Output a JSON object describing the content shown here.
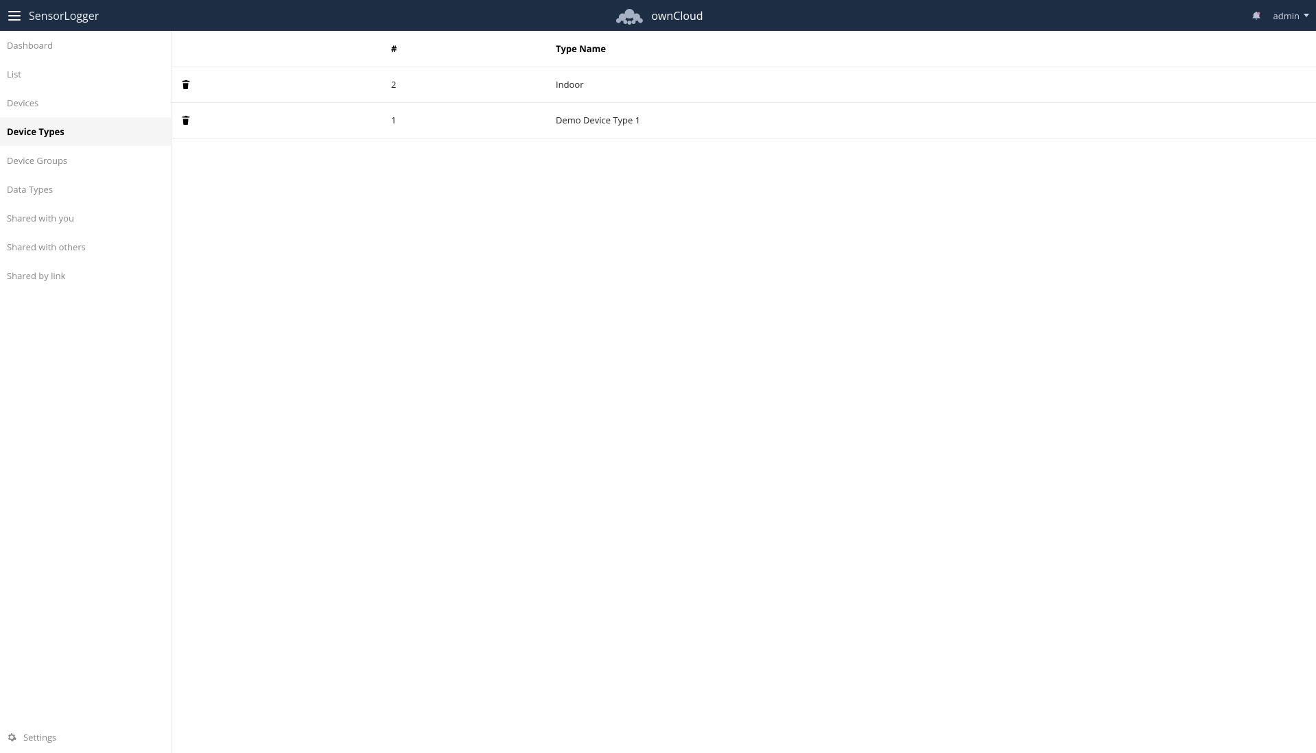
{
  "header": {
    "app_title": "SensorLogger",
    "brand": "ownCloud",
    "user_label": "admin"
  },
  "sidebar": {
    "items": [
      {
        "label": "Dashboard",
        "active": false
      },
      {
        "label": "List",
        "active": false
      },
      {
        "label": "Devices",
        "active": false
      },
      {
        "label": "Device Types",
        "active": true
      },
      {
        "label": "Device Groups",
        "active": false
      },
      {
        "label": "Data Types",
        "active": false
      },
      {
        "label": "Shared with you",
        "active": false
      },
      {
        "label": "Shared with others",
        "active": false
      },
      {
        "label": "Shared by link",
        "active": false
      }
    ],
    "footer": {
      "settings_label": "Settings"
    }
  },
  "table": {
    "columns": {
      "id": "#",
      "name": "Type Name"
    },
    "rows": [
      {
        "id": "2",
        "name": "Indoor"
      },
      {
        "id": "1",
        "name": "Demo Device Type 1"
      }
    ]
  }
}
